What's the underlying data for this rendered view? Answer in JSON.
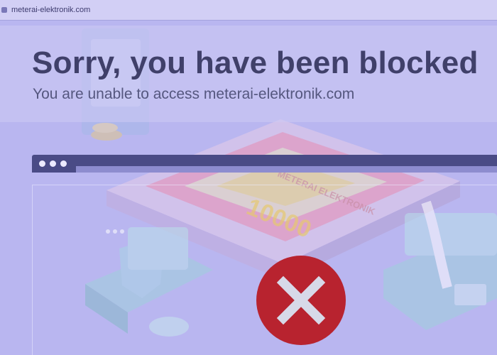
{
  "browser": {
    "url": "meterai-elektronik.com"
  },
  "blocked": {
    "title": "Sorry, you have been blocked",
    "subtitle": "You are unable to access meterai-elektronik.com"
  },
  "illustration": {
    "stamp_label": "METERAI ELEKTRONIK",
    "stamp_value": "10000"
  },
  "colors": {
    "background": "#b9b6f0",
    "heading": "#40406a",
    "window_bar": "#4a4b86",
    "error_red": "#b8232f"
  },
  "icons": {
    "error": "close-icon"
  }
}
